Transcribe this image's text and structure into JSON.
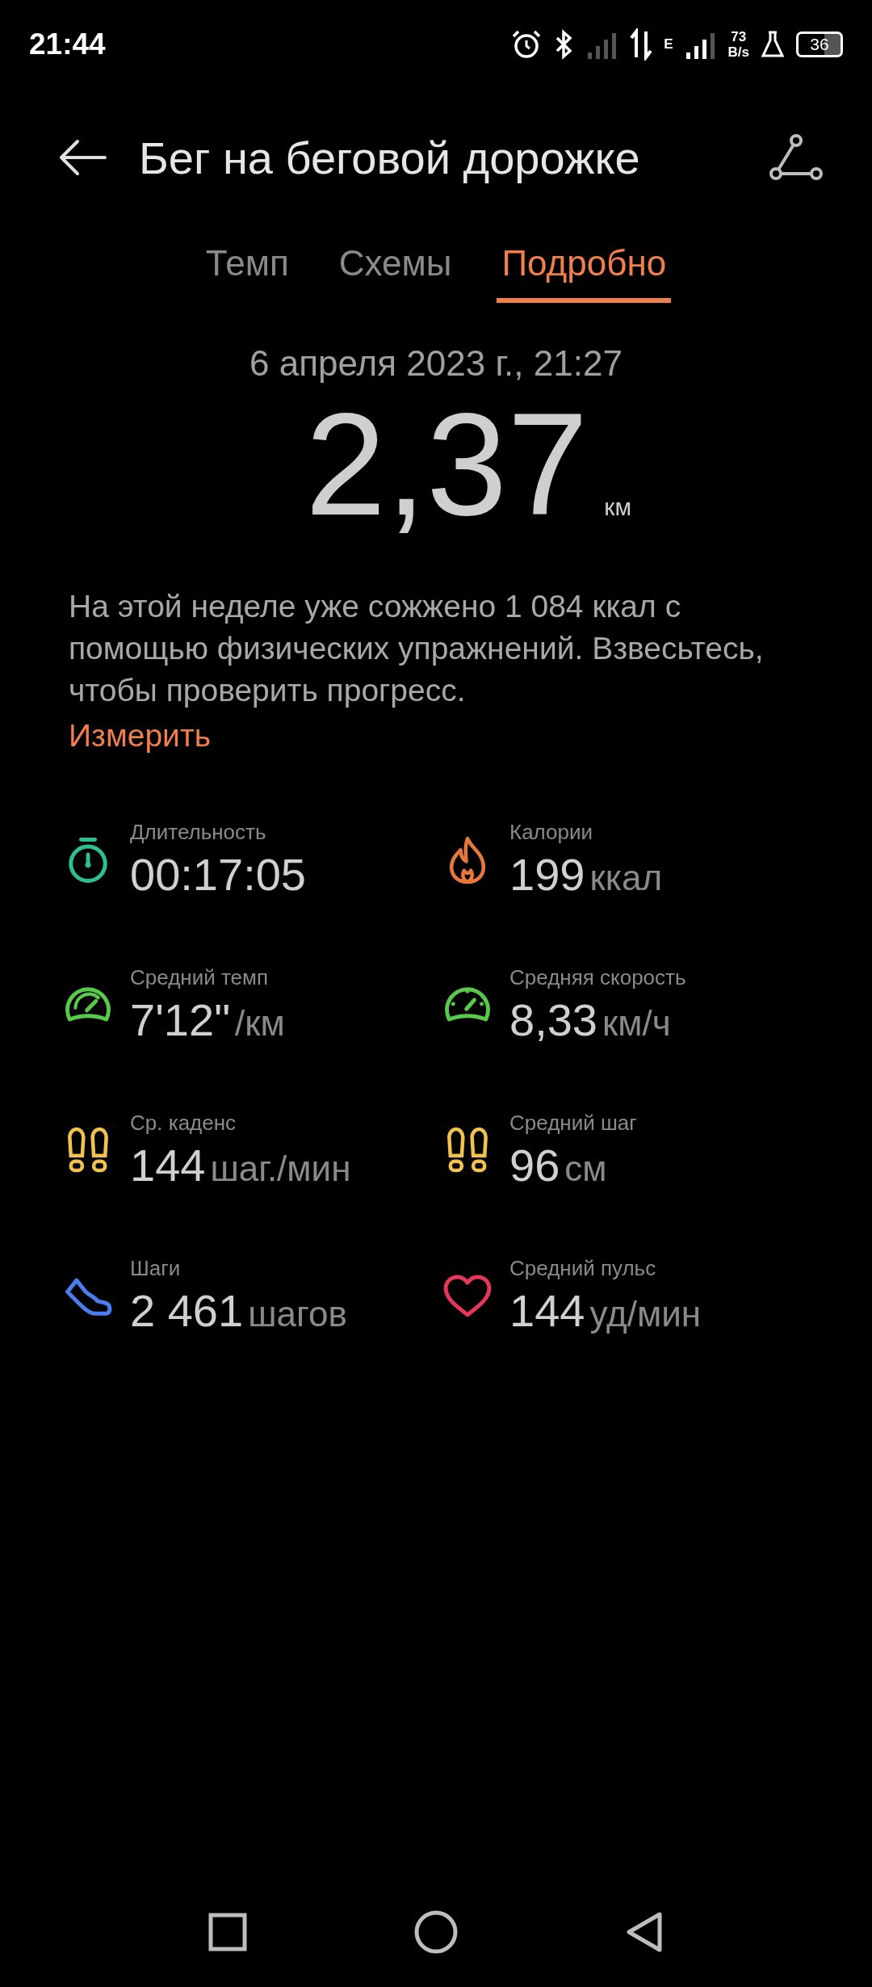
{
  "status_bar": {
    "time": "21:44",
    "network_type": "E",
    "speed_value": "73",
    "speed_unit": "B/s",
    "battery": "36"
  },
  "header": {
    "title": "Бег на беговой дорожке"
  },
  "tabs": [
    {
      "label": "Темп",
      "selected": false
    },
    {
      "label": "Схемы",
      "selected": false
    },
    {
      "label": "Подробно",
      "selected": true
    }
  ],
  "summary": {
    "date": "6 апреля 2023 г., 21:27",
    "distance": "2,37",
    "distance_unit": "км"
  },
  "notice": {
    "text": "На этой неделе уже сожжено 1 084 ккал с помощью физических упражнений. Взвесьтесь, чтобы проверить прогресс.",
    "link": "Измерить"
  },
  "metrics": [
    {
      "kind": "stopwatch",
      "label": "Длительность",
      "value": "00:17:05"
    },
    {
      "kind": "flame",
      "label": "Калории",
      "value": "199",
      "unit": "ккал"
    },
    {
      "kind": "gauge",
      "label": "Средний темп",
      "value": "7'12\"",
      "unit": "/км"
    },
    {
      "kind": "speedometer",
      "label": "Средняя скорость",
      "value": "8,33",
      "unit": "км/ч"
    },
    {
      "kind": "footprints",
      "label": "Ср. каденс",
      "value": "144",
      "unit": "шаг./мин"
    },
    {
      "kind": "footprints",
      "label": "Средний шаг",
      "value": "96",
      "unit": "см"
    },
    {
      "kind": "shoe",
      "label": "Шаги",
      "value": "2 461",
      "unit": "шагов"
    },
    {
      "kind": "heart",
      "label": "Средний пульс",
      "value": "144",
      "unit": "уд/мин"
    }
  ]
}
